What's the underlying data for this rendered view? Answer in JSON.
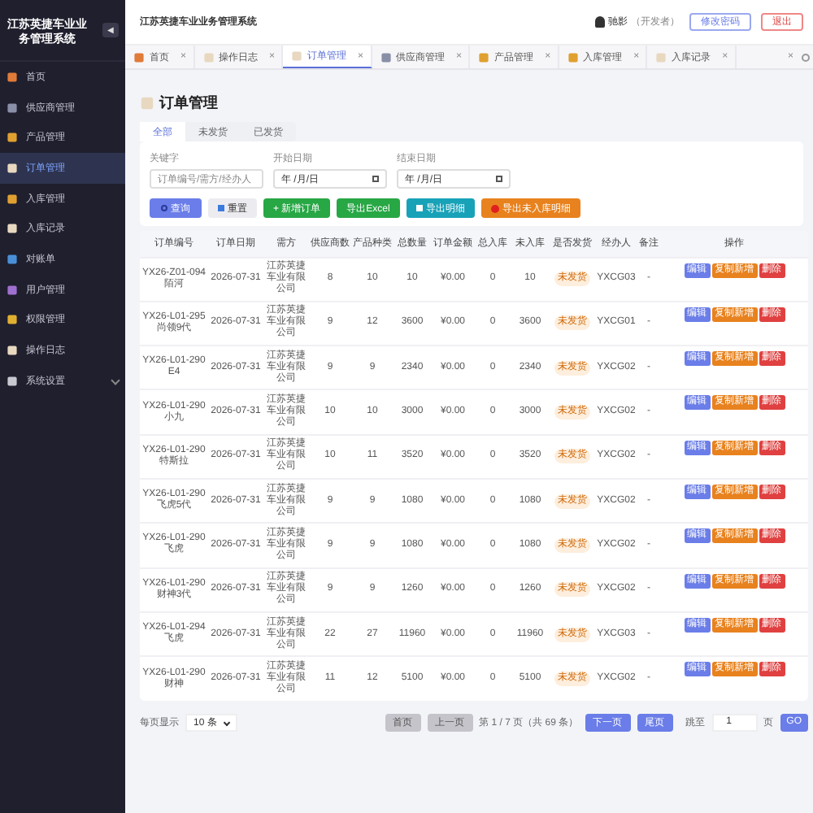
{
  "sidebar": {
    "title": "江苏英捷车业业务管理系统",
    "collapse_icon": "◀",
    "items": [
      {
        "label": "首页",
        "selected": false
      },
      {
        "label": "供应商管理",
        "selected": false
      },
      {
        "label": "产品管理",
        "selected": false
      },
      {
        "label": "订单管理",
        "selected": true
      },
      {
        "label": "入库管理",
        "selected": false
      },
      {
        "label": "入库记录",
        "selected": false
      },
      {
        "label": "对账单",
        "selected": false
      },
      {
        "label": "用户管理",
        "selected": false
      },
      {
        "label": "权限管理",
        "selected": false
      },
      {
        "label": "操作日志",
        "selected": false
      },
      {
        "label": "系统设置",
        "selected": false,
        "expandable": true
      }
    ]
  },
  "header": {
    "title": "江苏英捷车业业务管理系统",
    "user": "驰影",
    "role": "（开发者）",
    "buttons": [
      {
        "label": "修改密码",
        "kind": "primary"
      },
      {
        "label": "退出",
        "kind": "danger"
      }
    ]
  },
  "tabs": [
    {
      "label": "首页",
      "selected": false
    },
    {
      "label": "操作日志",
      "selected": false
    },
    {
      "label": "订单管理",
      "selected": true
    },
    {
      "label": "供应商管理",
      "selected": false
    },
    {
      "label": "产品管理",
      "selected": false
    },
    {
      "label": "入库管理",
      "selected": false
    },
    {
      "label": "入库记录",
      "selected": false
    }
  ],
  "tab_close": "×",
  "tab_close_all": "×",
  "page": {
    "title": "订单管理",
    "filters": [
      {
        "label": "全部",
        "selected": true
      },
      {
        "label": "未发货",
        "selected": false
      },
      {
        "label": "已发货",
        "selected": false
      }
    ],
    "fields": [
      {
        "label": "关键字",
        "placeholder": "订单编号/需方/经办人",
        "kind": "text"
      },
      {
        "label": "开始日期",
        "placeholder": "年 /月/日",
        "kind": "date"
      },
      {
        "label": "结束日期",
        "placeholder": "年 /月/日",
        "kind": "date"
      }
    ],
    "actions": [
      {
        "label": "查询",
        "kind": "query"
      },
      {
        "label": "重置",
        "kind": "reset"
      },
      {
        "label": "+ 新增订单",
        "kind": "add"
      },
      {
        "label": "导出Excel",
        "kind": "excel"
      },
      {
        "label": "导出明细",
        "kind": "detail"
      },
      {
        "label": "导出未入库明细",
        "kind": "pending"
      }
    ]
  },
  "table": {
    "columns": [
      "订单编号",
      "订单日期",
      "需方",
      "供应商数",
      "产品种类",
      "总数量",
      "订单金额",
      "总入库",
      "未入库",
      "是否发货",
      "经办人",
      "备注",
      "操作"
    ],
    "rows": [
      {
        "cells": [
          "YX26-Z01-094陌河",
          "2026-07-31",
          "江苏英捷车业有限公司",
          "8",
          "10",
          "10",
          "¥0.00",
          "0",
          "10",
          "未发货",
          "YXCG03",
          "-"
        ],
        "actions": [
          {
            "label": "编辑",
            "kind": "edit"
          },
          {
            "label": "复制新增",
            "kind": "copy"
          },
          {
            "label": "删除",
            "kind": "delete"
          }
        ]
      },
      {
        "cells": [
          "YX26-L01-295尚领9代",
          "2026-07-31",
          "江苏英捷车业有限公司",
          "9",
          "12",
          "3600",
          "¥0.00",
          "0",
          "3600",
          "未发货",
          "YXCG01",
          "-"
        ],
        "actions": [
          {
            "label": "编辑",
            "kind": "edit"
          },
          {
            "label": "复制新增",
            "kind": "copy"
          },
          {
            "label": "删除",
            "kind": "delete"
          }
        ]
      },
      {
        "cells": [
          "YX26-L01-290 E4",
          "2026-07-31",
          "江苏英捷车业有限公司",
          "9",
          "9",
          "2340",
          "¥0.00",
          "0",
          "2340",
          "未发货",
          "YXCG02",
          "-"
        ],
        "actions": [
          {
            "label": "编辑",
            "kind": "edit"
          },
          {
            "label": "复制新增",
            "kind": "copy"
          },
          {
            "label": "删除",
            "kind": "delete"
          }
        ]
      },
      {
        "cells": [
          "YX26-L01-290小九",
          "2026-07-31",
          "江苏英捷车业有限公司",
          "10",
          "10",
          "3000",
          "¥0.00",
          "0",
          "3000",
          "未发货",
          "YXCG02",
          "-"
        ],
        "actions": [
          {
            "label": "编辑",
            "kind": "edit"
          },
          {
            "label": "复制新增",
            "kind": "copy"
          },
          {
            "label": "删除",
            "kind": "delete"
          }
        ]
      },
      {
        "cells": [
          "YX26-L01-290特斯拉",
          "2026-07-31",
          "江苏英捷车业有限公司",
          "10",
          "11",
          "3520",
          "¥0.00",
          "0",
          "3520",
          "未发货",
          "YXCG02",
          "-"
        ],
        "actions": [
          {
            "label": "编辑",
            "kind": "edit"
          },
          {
            "label": "复制新增",
            "kind": "copy"
          },
          {
            "label": "删除",
            "kind": "delete"
          }
        ]
      },
      {
        "cells": [
          "YX26-L01-290飞虎5代",
          "2026-07-31",
          "江苏英捷车业有限公司",
          "9",
          "9",
          "1080",
          "¥0.00",
          "0",
          "1080",
          "未发货",
          "YXCG02",
          "-"
        ],
        "actions": [
          {
            "label": "编辑",
            "kind": "edit"
          },
          {
            "label": "复制新增",
            "kind": "copy"
          },
          {
            "label": "删除",
            "kind": "delete"
          }
        ]
      },
      {
        "cells": [
          "YX26-L01-290飞虎",
          "2026-07-31",
          "江苏英捷车业有限公司",
          "9",
          "9",
          "1080",
          "¥0.00",
          "0",
          "1080",
          "未发货",
          "YXCG02",
          "-"
        ],
        "actions": [
          {
            "label": "编辑",
            "kind": "edit"
          },
          {
            "label": "复制新增",
            "kind": "copy"
          },
          {
            "label": "删除",
            "kind": "delete"
          }
        ]
      },
      {
        "cells": [
          "YX26-L01-290财神3代",
          "2026-07-31",
          "江苏英捷车业有限公司",
          "9",
          "9",
          "1260",
          "¥0.00",
          "0",
          "1260",
          "未发货",
          "YXCG02",
          "-"
        ],
        "actions": [
          {
            "label": "编辑",
            "kind": "edit"
          },
          {
            "label": "复制新增",
            "kind": "copy"
          },
          {
            "label": "删除",
            "kind": "delete"
          }
        ]
      },
      {
        "cells": [
          "YX26-L01-294飞虎",
          "2026-07-31",
          "江苏英捷车业有限公司",
          "22",
          "27",
          "11960",
          "¥0.00",
          "0",
          "11960",
          "未发货",
          "YXCG03",
          "-"
        ],
        "actions": [
          {
            "label": "编辑",
            "kind": "edit"
          },
          {
            "label": "复制新增",
            "kind": "copy"
          },
          {
            "label": "删除",
            "kind": "delete"
          }
        ]
      },
      {
        "cells": [
          "YX26-L01-290财神",
          "2026-07-31",
          "江苏英捷车业有限公司",
          "11",
          "12",
          "5100",
          "¥0.00",
          "0",
          "5100",
          "未发货",
          "YXCG02",
          "-"
        ],
        "actions": [
          {
            "label": "编辑",
            "kind": "edit"
          },
          {
            "label": "复制新增",
            "kind": "copy"
          },
          {
            "label": "删除",
            "kind": "delete"
          }
        ]
      }
    ]
  },
  "pagination": {
    "page_size_label": "每页显示",
    "page_size": "10 条",
    "buttons": [
      {
        "label": "首页",
        "disabled": true
      },
      {
        "label": "上一页",
        "disabled": true
      }
    ],
    "info": "第 1 / 7 页（共 69 条）",
    "next_buttons": [
      {
        "label": "下一页",
        "disabled": false
      },
      {
        "label": "尾页",
        "disabled": false
      }
    ],
    "jump_label": "跳至",
    "jump_value": "1",
    "page_unit": "页",
    "go": "GO"
  }
}
